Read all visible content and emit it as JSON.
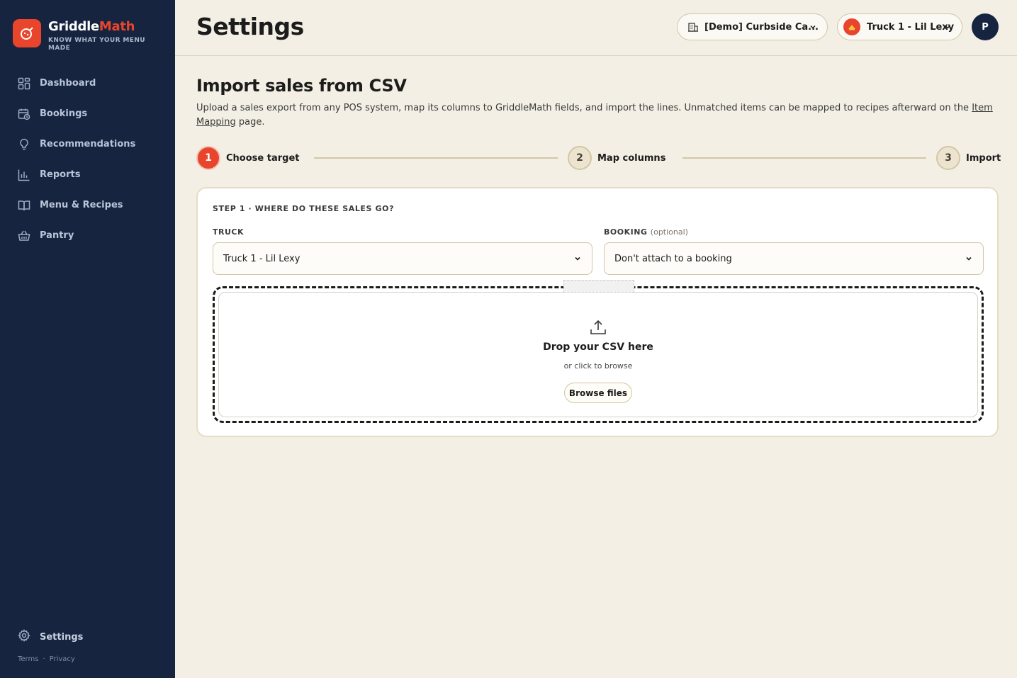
{
  "brand": {
    "name_part1": "Griddle",
    "name_part2": "Math",
    "tagline": "KNOW WHAT YOUR MENU MADE"
  },
  "sidebar": {
    "items": [
      {
        "label": "Dashboard",
        "icon": "dashboard-icon"
      },
      {
        "label": "Bookings",
        "icon": "calendar-clock-icon"
      },
      {
        "label": "Recommendations",
        "icon": "lightbulb-icon"
      },
      {
        "label": "Reports",
        "icon": "bar-chart-icon"
      },
      {
        "label": "Menu & Recipes",
        "icon": "book-icon"
      },
      {
        "label": "Pantry",
        "icon": "basket-icon"
      }
    ],
    "settings_label": "Settings",
    "footer": {
      "terms": "Terms",
      "separator": "·",
      "privacy": "Privacy"
    }
  },
  "header": {
    "title": "Settings",
    "org_selector": "[Demo] Curbside Ca...",
    "truck_selector": "Truck 1 - Lil Lexy",
    "user_initial": "P"
  },
  "main": {
    "title": "Import sales from CSV",
    "description_before_link": "Upload a sales export from any POS system, map its columns to GriddleMath fields, and import the lines. Unmatched items can be mapped to recipes afterward on the ",
    "description_link": "Item Mapping",
    "description_after_link": " page.",
    "steps": [
      {
        "number": "1",
        "label": "Choose target",
        "active": true
      },
      {
        "number": "2",
        "label": "Map columns",
        "active": false
      },
      {
        "number": "3",
        "label": "Import",
        "active": false
      }
    ],
    "card": {
      "heading": "STEP 1 · WHERE DO THESE SALES GO?",
      "truck_label": "TRUCK",
      "truck_value": "Truck 1 - Lil Lexy",
      "booking_label": "BOOKING",
      "booking_optional": "(optional)",
      "booking_value": "Don't attach to a booking",
      "drop_title": "Drop your CSV here",
      "drop_subtitle": "or click to browse",
      "browse_button": "Browse files"
    }
  },
  "colors": {
    "sidebar_bg": "#16243f",
    "accent": "#e8452c",
    "page_bg": "#f3efe4",
    "border_tan": "#d3c6a6"
  }
}
